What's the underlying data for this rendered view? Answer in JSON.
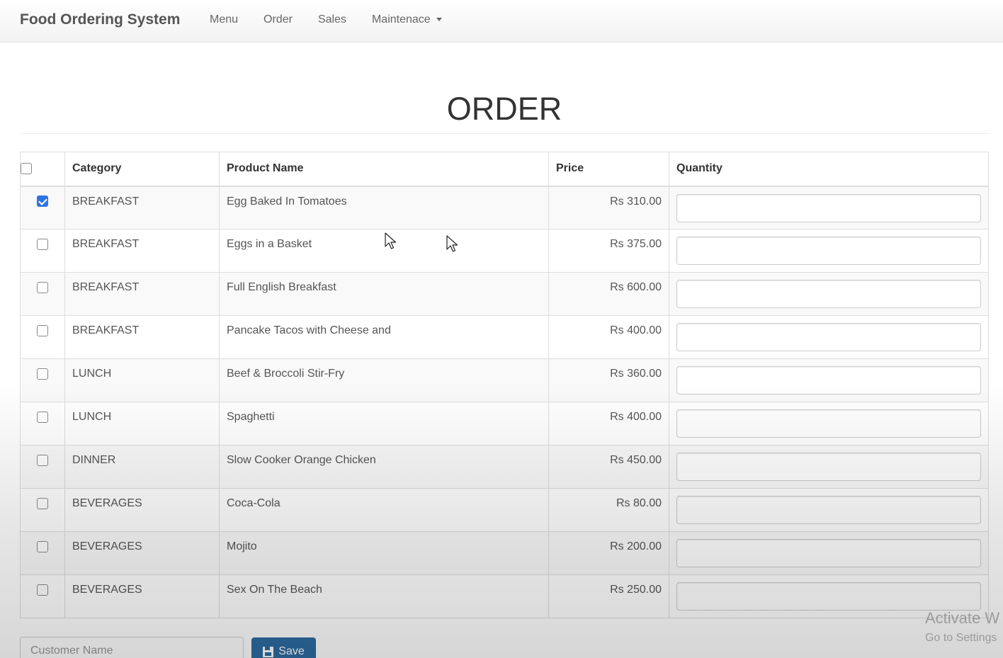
{
  "navbar": {
    "brand": "Food Ordering System",
    "items": [
      {
        "label": "Menu"
      },
      {
        "label": "Order"
      },
      {
        "label": "Sales"
      },
      {
        "label": "Maintenace",
        "dropdown": true
      }
    ]
  },
  "page": {
    "title": "ORDER"
  },
  "table": {
    "headers": {
      "category": "Category",
      "product": "Product Name",
      "price": "Price",
      "quantity": "Quantity"
    },
    "rows": [
      {
        "checked": true,
        "category": "BREAKFAST",
        "product": "Egg Baked In Tomatoes",
        "price": "Rs 310.00",
        "quantity": ""
      },
      {
        "checked": false,
        "category": "BREAKFAST",
        "product": "Eggs in a Basket",
        "price": "Rs 375.00",
        "quantity": ""
      },
      {
        "checked": false,
        "category": "BREAKFAST",
        "product": "Full English Breakfast",
        "price": "Rs 600.00",
        "quantity": ""
      },
      {
        "checked": false,
        "category": "BREAKFAST",
        "product": "Pancake Tacos with Cheese and",
        "price": "Rs 400.00",
        "quantity": ""
      },
      {
        "checked": false,
        "category": "LUNCH",
        "product": "Beef & Broccoli Stir-Fry",
        "price": "Rs 360.00",
        "quantity": ""
      },
      {
        "checked": false,
        "category": "LUNCH",
        "product": "Spaghetti",
        "price": "Rs 400.00",
        "quantity": ""
      },
      {
        "checked": false,
        "category": "DINNER",
        "product": "Slow Cooker Orange Chicken",
        "price": "Rs 450.00",
        "quantity": ""
      },
      {
        "checked": false,
        "category": "BEVERAGES",
        "product": "Coca-Cola",
        "price": "Rs 80.00",
        "quantity": ""
      },
      {
        "checked": false,
        "category": "BEVERAGES",
        "product": "Mojito",
        "price": "Rs 200.00",
        "quantity": ""
      },
      {
        "checked": false,
        "category": "BEVERAGES",
        "product": "Sex On The Beach",
        "price": "Rs 250.00",
        "quantity": ""
      }
    ]
  },
  "form": {
    "customer_name_placeholder": "Customer Name",
    "customer_name_value": "",
    "save_label": "Save",
    "save_icon": "floppy-disk-icon"
  },
  "watermark": {
    "line1": "Activate W",
    "line2": "Go to Settings"
  },
  "colors": {
    "accent": "#2d6ca2",
    "checkbox_checked": "#2f73e0"
  }
}
